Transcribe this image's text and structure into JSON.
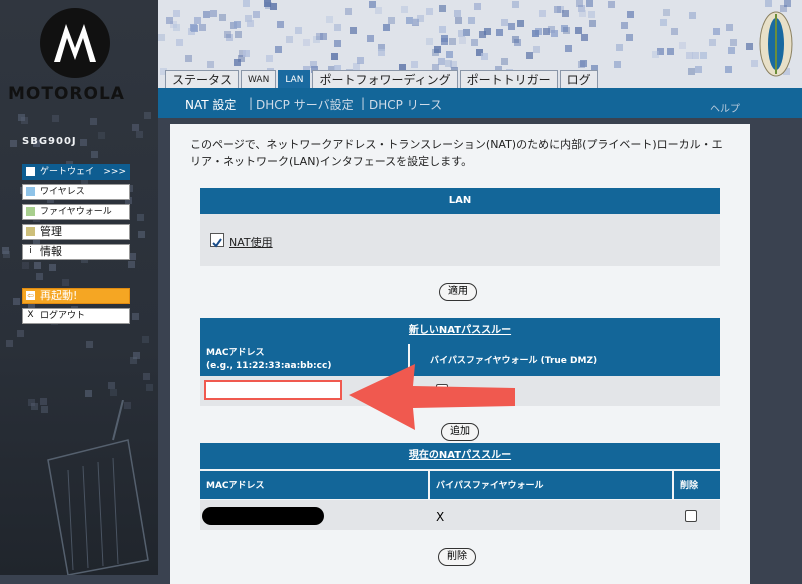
{
  "brand": {
    "name": "MOTOROLA",
    "model": "SBG900J"
  },
  "tabs": [
    {
      "label": "ステータス"
    },
    {
      "label": "WAN"
    },
    {
      "label": "LAN"
    },
    {
      "label": "ポートフォワーディング"
    },
    {
      "label": "ポートトリガー"
    },
    {
      "label": "ログ"
    }
  ],
  "subnav": {
    "nat": "NAT 設定",
    "dhcp_server": "DHCP サーバ設定",
    "dhcp_lease": "DHCP リース",
    "help": "ヘルプ",
    "sep": "|"
  },
  "sidebar": {
    "items": [
      {
        "label": "ゲートウェイ",
        "suffix": ">>>",
        "color": "#ffffff"
      },
      {
        "label": "ワイヤレス",
        "color": "#8fc3e8"
      },
      {
        "label": "ファイヤウォール",
        "color": "#a8cf8e"
      },
      {
        "label": "管理",
        "color": "#cdbf7a"
      },
      {
        "label": "情報",
        "icon_char": "i"
      },
      {
        "label": "再起動!",
        "icon_char": "⇦"
      },
      {
        "label": "ログアウト",
        "icon_char": "X"
      }
    ]
  },
  "main": {
    "intro": "このページで、ネットワークアドレス・トランスレーション(NAT)のために内部(プライベート)ローカル・エリア・ネットワーク(LAN)インタフェースを設定します。",
    "lan_section": {
      "title": "LAN",
      "nat_label": "NAT使用",
      "nat_checked": true,
      "apply": "適用"
    },
    "new_pass": {
      "title": "新しいNATパススルー",
      "mac_header": "MACアドレス",
      "mac_example": "(e.g., 11:22:33:aa:bb:cc)",
      "bypass_header": "バイパスファイヤウォール (True DMZ)",
      "mac_value": "",
      "add": "追加"
    },
    "current_pass": {
      "title": "現在のNATパススルー",
      "headers": [
        "MACアドレス",
        "バイパスファイヤウォール",
        "削除"
      ],
      "rows": [
        {
          "bypass": "X"
        }
      ],
      "delete": "削除"
    }
  },
  "colors": {
    "accent": "#136699",
    "arrow": "#f0594f",
    "alert": "#f5a623"
  }
}
